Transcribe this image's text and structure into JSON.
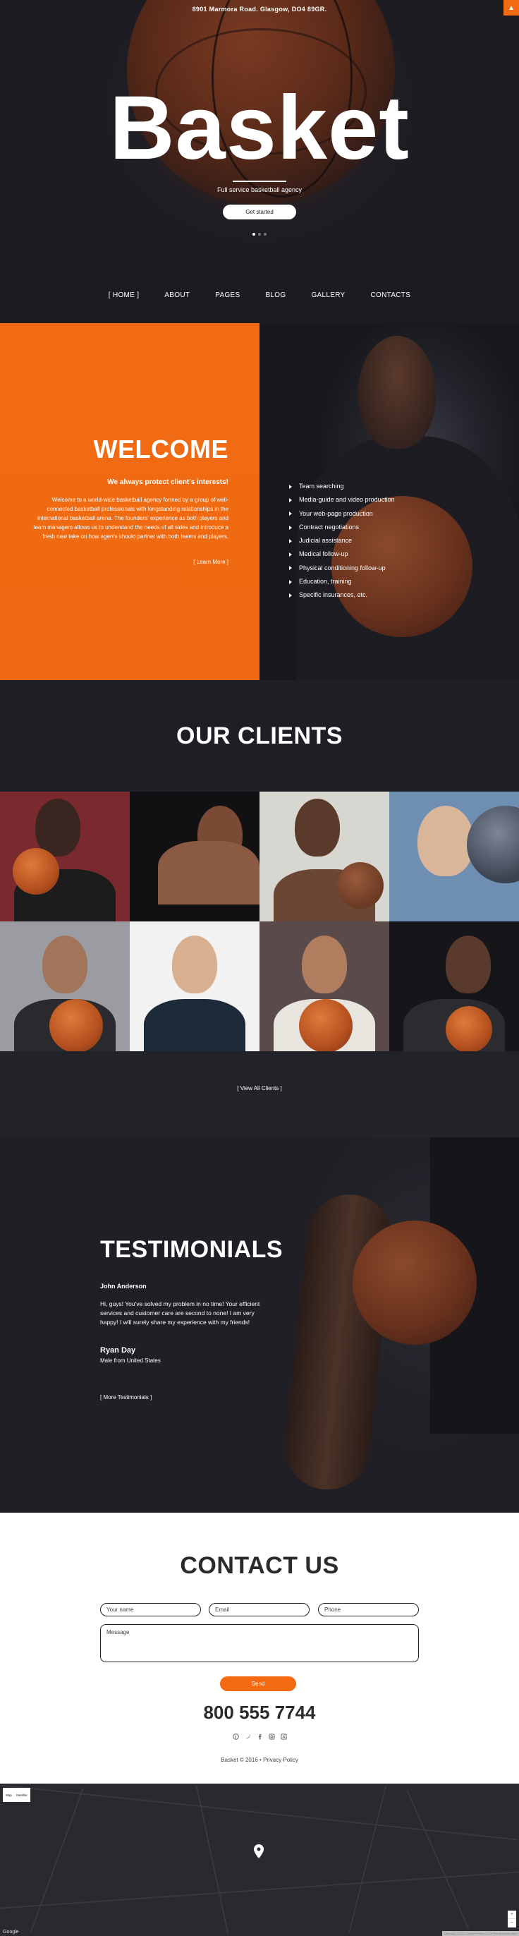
{
  "hero": {
    "address": "8901 Marmora Road. Glasgow, DO4 89GR.",
    "title": "Basket",
    "subtitle": "Full service basketball agency",
    "cta_label": "Get started",
    "scroll_up_label": "▲"
  },
  "nav": {
    "items": [
      "[ HOME ]",
      "ABOUT",
      "PAGES",
      "BLOG",
      "GALLERY",
      "CONTACTS"
    ]
  },
  "welcome": {
    "title": "WELCOME",
    "lead": "We always protect client's interests!",
    "text": "Welcome to a world-wide basketball agency formed by a group of well-connected basketball professionals with longstanding relationships in the international basketball arena. The founders' experience as both players and team managers allows us to understand the needs of all sides and introduce a fresh new take on how agents should partner with both teams and players.",
    "more_label": "[ Learn More ]",
    "services": [
      "Team searching",
      "Media-guide and video production",
      "Your web-page production",
      "Contract negotiations",
      "Judicial assistance",
      "Medical follow-up",
      "Physical conditioning follow-up",
      "Education, training",
      "Specific insurances, etc."
    ]
  },
  "clients": {
    "title": "OUR CLIENTS",
    "view_all_label": "[ View All Clients ]"
  },
  "testimonials": {
    "title": "TESTIMONIALS",
    "name": "John Anderson",
    "quote": "Hi, guys! You've solved my problem in no time! Your efficient services and customer care are second to none! I am very happy! I will surely share my experience with my friends!",
    "author": "Ryan Day",
    "author_from": "Male from United States",
    "more_label": "[ More Testimonials ]"
  },
  "contact": {
    "title": "CONTACT US",
    "name_placeholder": "Your name",
    "email_placeholder": "Email",
    "phone_placeholder": "Phone",
    "message_placeholder": "Message",
    "send_label": "Send",
    "phone_number": "800 555 7744",
    "social_icons": [
      "pinterest-icon",
      "twitter-icon",
      "facebook-icon",
      "instagram-icon",
      "dribbble-icon"
    ],
    "copyright": "Basket © 2016 • Privacy Policy"
  },
  "map": {
    "type_map": "Map",
    "type_satellite": "Satellite",
    "logo": "Google",
    "zoom_in": "+",
    "zoom_out": "−",
    "terms": "Map data ©2016 Google  Terms of Use  Report a map error"
  },
  "colors": {
    "accent": "#f46a12",
    "dark_bg": "#1f1f25"
  }
}
